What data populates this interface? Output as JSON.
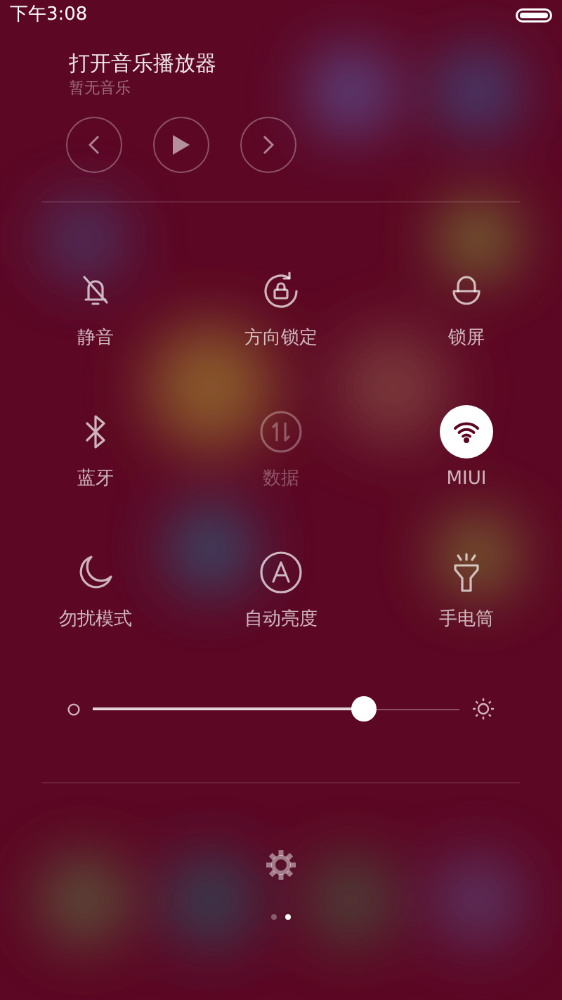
{
  "status_bar": {
    "time": "下午3:08"
  },
  "music": {
    "title": "打开音乐播放器",
    "subtitle": "暂无音乐"
  },
  "toggles": [
    {
      "label": "静音",
      "on": false,
      "disabled": false
    },
    {
      "label": "方向锁定",
      "on": false,
      "disabled": false
    },
    {
      "label": "锁屏",
      "on": false,
      "disabled": false
    },
    {
      "label": "蓝牙",
      "on": false,
      "disabled": false
    },
    {
      "label": "数据",
      "on": false,
      "disabled": true
    },
    {
      "label": "MIUI",
      "on": true,
      "disabled": false
    },
    {
      "label": "勿扰模式",
      "on": false,
      "disabled": false
    },
    {
      "label": "自动亮度",
      "on": false,
      "disabled": false
    },
    {
      "label": "手电筒",
      "on": false,
      "disabled": false
    }
  ],
  "brightness": {
    "level": 0.74
  },
  "pages": [
    {
      "selected": false
    },
    {
      "selected": true
    }
  ]
}
